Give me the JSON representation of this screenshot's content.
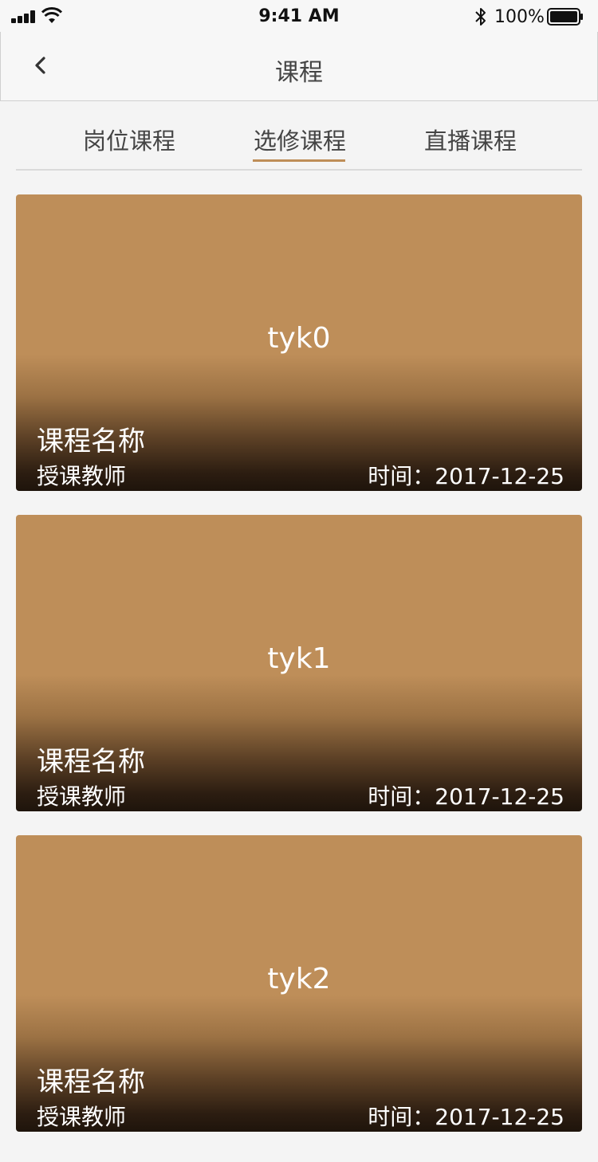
{
  "status_bar": {
    "time": "9:41 AM",
    "battery_percent": "100%"
  },
  "nav": {
    "title": "课程"
  },
  "tabs": [
    {
      "label": "岗位课程",
      "selected": false
    },
    {
      "label": "选修课程",
      "selected": true
    },
    {
      "label": "直播课程",
      "selected": false
    }
  ],
  "courses": [
    {
      "cover_label": "tyk0",
      "name": "课程名称",
      "teacher": "授课教师",
      "time": "时间：2017-12-25"
    },
    {
      "cover_label": "tyk1",
      "name": "课程名称",
      "teacher": "授课教师",
      "time": "时间：2017-12-25"
    },
    {
      "cover_label": "tyk2",
      "name": "课程名称",
      "teacher": "授课教师",
      "time": "时间：2017-12-25"
    }
  ],
  "colors": {
    "accent": "#be8e58",
    "background": "#f4f4f4",
    "card": "#be8e59"
  }
}
